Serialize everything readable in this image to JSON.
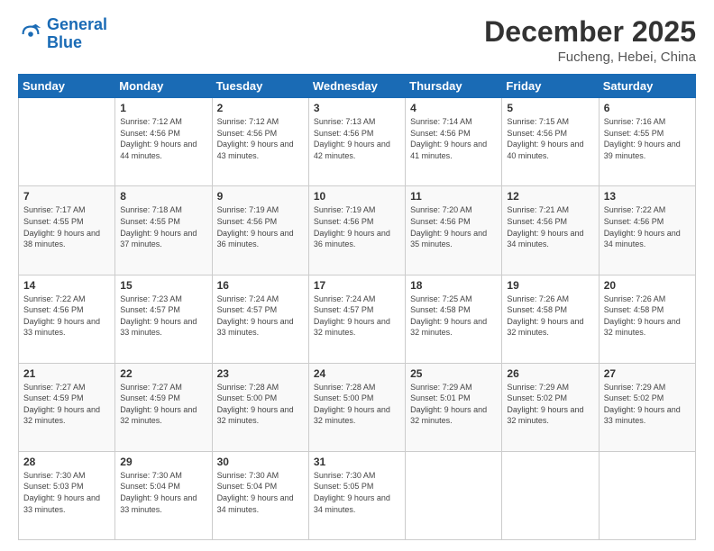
{
  "logo": {
    "line1": "General",
    "line2": "Blue"
  },
  "title": "December 2025",
  "location": "Fucheng, Hebei, China",
  "days_of_week": [
    "Sunday",
    "Monday",
    "Tuesday",
    "Wednesday",
    "Thursday",
    "Friday",
    "Saturday"
  ],
  "weeks": [
    [
      {
        "num": "",
        "sunrise": "",
        "sunset": "",
        "daylight": ""
      },
      {
        "num": "1",
        "sunrise": "Sunrise: 7:12 AM",
        "sunset": "Sunset: 4:56 PM",
        "daylight": "Daylight: 9 hours and 44 minutes."
      },
      {
        "num": "2",
        "sunrise": "Sunrise: 7:12 AM",
        "sunset": "Sunset: 4:56 PM",
        "daylight": "Daylight: 9 hours and 43 minutes."
      },
      {
        "num": "3",
        "sunrise": "Sunrise: 7:13 AM",
        "sunset": "Sunset: 4:56 PM",
        "daylight": "Daylight: 9 hours and 42 minutes."
      },
      {
        "num": "4",
        "sunrise": "Sunrise: 7:14 AM",
        "sunset": "Sunset: 4:56 PM",
        "daylight": "Daylight: 9 hours and 41 minutes."
      },
      {
        "num": "5",
        "sunrise": "Sunrise: 7:15 AM",
        "sunset": "Sunset: 4:56 PM",
        "daylight": "Daylight: 9 hours and 40 minutes."
      },
      {
        "num": "6",
        "sunrise": "Sunrise: 7:16 AM",
        "sunset": "Sunset: 4:55 PM",
        "daylight": "Daylight: 9 hours and 39 minutes."
      }
    ],
    [
      {
        "num": "7",
        "sunrise": "Sunrise: 7:17 AM",
        "sunset": "Sunset: 4:55 PM",
        "daylight": "Daylight: 9 hours and 38 minutes."
      },
      {
        "num": "8",
        "sunrise": "Sunrise: 7:18 AM",
        "sunset": "Sunset: 4:55 PM",
        "daylight": "Daylight: 9 hours and 37 minutes."
      },
      {
        "num": "9",
        "sunrise": "Sunrise: 7:19 AM",
        "sunset": "Sunset: 4:56 PM",
        "daylight": "Daylight: 9 hours and 36 minutes."
      },
      {
        "num": "10",
        "sunrise": "Sunrise: 7:19 AM",
        "sunset": "Sunset: 4:56 PM",
        "daylight": "Daylight: 9 hours and 36 minutes."
      },
      {
        "num": "11",
        "sunrise": "Sunrise: 7:20 AM",
        "sunset": "Sunset: 4:56 PM",
        "daylight": "Daylight: 9 hours and 35 minutes."
      },
      {
        "num": "12",
        "sunrise": "Sunrise: 7:21 AM",
        "sunset": "Sunset: 4:56 PM",
        "daylight": "Daylight: 9 hours and 34 minutes."
      },
      {
        "num": "13",
        "sunrise": "Sunrise: 7:22 AM",
        "sunset": "Sunset: 4:56 PM",
        "daylight": "Daylight: 9 hours and 34 minutes."
      }
    ],
    [
      {
        "num": "14",
        "sunrise": "Sunrise: 7:22 AM",
        "sunset": "Sunset: 4:56 PM",
        "daylight": "Daylight: 9 hours and 33 minutes."
      },
      {
        "num": "15",
        "sunrise": "Sunrise: 7:23 AM",
        "sunset": "Sunset: 4:57 PM",
        "daylight": "Daylight: 9 hours and 33 minutes."
      },
      {
        "num": "16",
        "sunrise": "Sunrise: 7:24 AM",
        "sunset": "Sunset: 4:57 PM",
        "daylight": "Daylight: 9 hours and 33 minutes."
      },
      {
        "num": "17",
        "sunrise": "Sunrise: 7:24 AM",
        "sunset": "Sunset: 4:57 PM",
        "daylight": "Daylight: 9 hours and 32 minutes."
      },
      {
        "num": "18",
        "sunrise": "Sunrise: 7:25 AM",
        "sunset": "Sunset: 4:58 PM",
        "daylight": "Daylight: 9 hours and 32 minutes."
      },
      {
        "num": "19",
        "sunrise": "Sunrise: 7:26 AM",
        "sunset": "Sunset: 4:58 PM",
        "daylight": "Daylight: 9 hours and 32 minutes."
      },
      {
        "num": "20",
        "sunrise": "Sunrise: 7:26 AM",
        "sunset": "Sunset: 4:58 PM",
        "daylight": "Daylight: 9 hours and 32 minutes."
      }
    ],
    [
      {
        "num": "21",
        "sunrise": "Sunrise: 7:27 AM",
        "sunset": "Sunset: 4:59 PM",
        "daylight": "Daylight: 9 hours and 32 minutes."
      },
      {
        "num": "22",
        "sunrise": "Sunrise: 7:27 AM",
        "sunset": "Sunset: 4:59 PM",
        "daylight": "Daylight: 9 hours and 32 minutes."
      },
      {
        "num": "23",
        "sunrise": "Sunrise: 7:28 AM",
        "sunset": "Sunset: 5:00 PM",
        "daylight": "Daylight: 9 hours and 32 minutes."
      },
      {
        "num": "24",
        "sunrise": "Sunrise: 7:28 AM",
        "sunset": "Sunset: 5:00 PM",
        "daylight": "Daylight: 9 hours and 32 minutes."
      },
      {
        "num": "25",
        "sunrise": "Sunrise: 7:29 AM",
        "sunset": "Sunset: 5:01 PM",
        "daylight": "Daylight: 9 hours and 32 minutes."
      },
      {
        "num": "26",
        "sunrise": "Sunrise: 7:29 AM",
        "sunset": "Sunset: 5:02 PM",
        "daylight": "Daylight: 9 hours and 32 minutes."
      },
      {
        "num": "27",
        "sunrise": "Sunrise: 7:29 AM",
        "sunset": "Sunset: 5:02 PM",
        "daylight": "Daylight: 9 hours and 33 minutes."
      }
    ],
    [
      {
        "num": "28",
        "sunrise": "Sunrise: 7:30 AM",
        "sunset": "Sunset: 5:03 PM",
        "daylight": "Daylight: 9 hours and 33 minutes."
      },
      {
        "num": "29",
        "sunrise": "Sunrise: 7:30 AM",
        "sunset": "Sunset: 5:04 PM",
        "daylight": "Daylight: 9 hours and 33 minutes."
      },
      {
        "num": "30",
        "sunrise": "Sunrise: 7:30 AM",
        "sunset": "Sunset: 5:04 PM",
        "daylight": "Daylight: 9 hours and 34 minutes."
      },
      {
        "num": "31",
        "sunrise": "Sunrise: 7:30 AM",
        "sunset": "Sunset: 5:05 PM",
        "daylight": "Daylight: 9 hours and 34 minutes."
      },
      {
        "num": "",
        "sunrise": "",
        "sunset": "",
        "daylight": ""
      },
      {
        "num": "",
        "sunrise": "",
        "sunset": "",
        "daylight": ""
      },
      {
        "num": "",
        "sunrise": "",
        "sunset": "",
        "daylight": ""
      }
    ]
  ]
}
